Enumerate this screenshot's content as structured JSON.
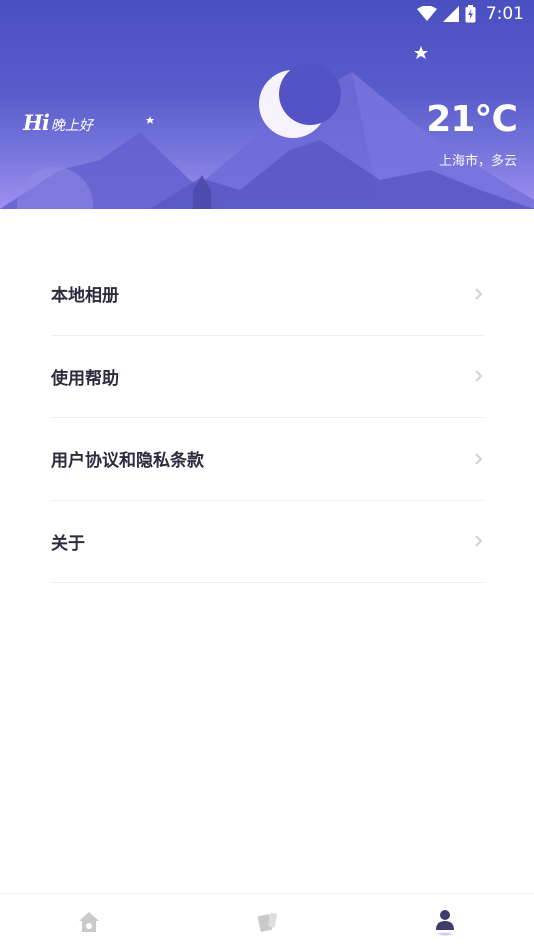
{
  "status_bar": {
    "time": "7:01",
    "icons": [
      "wifi-icon",
      "cell-signal-icon",
      "battery-charging-icon"
    ]
  },
  "header": {
    "greeting_prefix": "Hi",
    "greeting_text": "晚上好",
    "temperature": "21℃",
    "location_weather": "上海市，多云",
    "colors": {
      "gradient_top": "#4a4fc0",
      "gradient_bottom": "#a08ef0",
      "mountain": "#6a67d6"
    }
  },
  "menu": {
    "items": [
      {
        "label": "本地相册",
        "icon": "chevron-right-icon"
      },
      {
        "label": "使用帮助",
        "icon": "chevron-right-icon"
      },
      {
        "label": "用户协议和隐私条款",
        "icon": "chevron-right-icon"
      },
      {
        "label": "关于",
        "icon": "chevron-right-icon"
      }
    ]
  },
  "tabbar": {
    "tabs": [
      {
        "icon": "home-icon",
        "active": false
      },
      {
        "icon": "cards-icon",
        "active": false
      },
      {
        "icon": "profile-icon",
        "active": true
      }
    ],
    "colors": {
      "inactive": "#c9c9c9",
      "active": "#3f3d6e"
    }
  }
}
